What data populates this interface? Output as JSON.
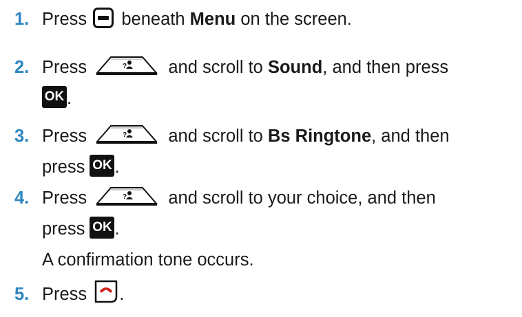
{
  "colors": {
    "step_number": "#2e86c1",
    "text": "#1a1a1a",
    "end_call_red": "#d0211c"
  },
  "steps": [
    {
      "number": "1.",
      "parts": {
        "press": "Press",
        "text1": "beneath",
        "bold": "Menu",
        "text2": "on the screen."
      },
      "icons": [
        "menu-softkey-icon"
      ]
    },
    {
      "number": "2.",
      "parts": {
        "press": "Press",
        "text1": "and scroll to",
        "bold": "Sound",
        "text2": ", and then press",
        "end": "."
      },
      "icons": [
        "navigation-key-icon",
        "ok-key-icon"
      ]
    },
    {
      "number": "3.",
      "parts": {
        "press": "Press",
        "text1": "and scroll to",
        "bold": "Bs Ringtone",
        "text2": ", and then",
        "press2": "press",
        "end": "."
      },
      "icons": [
        "navigation-key-icon",
        "ok-key-icon"
      ]
    },
    {
      "number": "4.",
      "parts": {
        "press": "Press",
        "text1": "and scroll to your choice, and then",
        "press2": "press",
        "end": ".",
        "note": "A confirmation tone occurs."
      },
      "icons": [
        "navigation-key-icon",
        "ok-key-icon"
      ]
    },
    {
      "number": "5.",
      "parts": {
        "press": "Press",
        "end": "."
      },
      "icons": [
        "end-call-key-icon"
      ]
    }
  ],
  "ok_label": "OK"
}
